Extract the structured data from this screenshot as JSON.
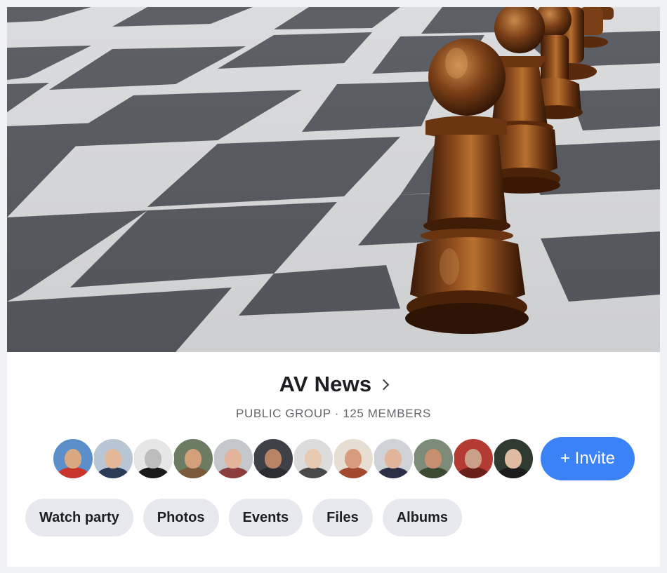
{
  "group": {
    "name": "AV News",
    "privacy": "PUBLIC GROUP",
    "separator": "·",
    "member_count": "125 MEMBERS"
  },
  "cover": {
    "icon": "chess-board-photo",
    "subject": "giant wooden pawn chess pieces on a checkered board"
  },
  "members": [
    {
      "id": "m1",
      "bg": "#5b8fc9",
      "skin": "#d8a883",
      "shirt": "#c9342b"
    },
    {
      "id": "m2",
      "bg": "#b9c6d4",
      "skin": "#e3b898",
      "shirt": "#2a3a57"
    },
    {
      "id": "m3",
      "bg": "#e6e6e6",
      "skin": "#bdbdbd",
      "shirt": "#1a1a1a"
    },
    {
      "id": "m4",
      "bg": "#6b7c63",
      "skin": "#d3a079",
      "shirt": "#7a5a3a"
    },
    {
      "id": "m5",
      "bg": "#c4c7cc",
      "skin": "#e4b49a",
      "shirt": "#8c3d3d"
    },
    {
      "id": "m6",
      "bg": "#3e4147",
      "skin": "#b98466",
      "shirt": "#2b2d31"
    },
    {
      "id": "m7",
      "bg": "#dcdcdc",
      "skin": "#e8c9b2",
      "shirt": "#4a4a4a"
    },
    {
      "id": "m8",
      "bg": "#e6ddd3",
      "skin": "#d89b7e",
      "shirt": "#a14a2f"
    },
    {
      "id": "m9",
      "bg": "#cfd3d8",
      "skin": "#e2b59a",
      "shirt": "#2a2f45"
    },
    {
      "id": "m10",
      "bg": "#7d8c78",
      "skin": "#c78e6f",
      "shirt": "#3c4a34"
    },
    {
      "id": "m11",
      "bg": "#b33b33",
      "skin": "#caa08a",
      "shirt": "#6a1f1b"
    },
    {
      "id": "m12",
      "bg": "#2f3a31",
      "skin": "#e0bba3",
      "shirt": "#1c1c1c"
    }
  ],
  "actions": {
    "invite_label": "+ Invite",
    "chevron_icon": "chevron-right-icon"
  },
  "tabs": [
    {
      "label": "Watch party"
    },
    {
      "label": "Photos"
    },
    {
      "label": "Events"
    },
    {
      "label": "Files"
    },
    {
      "label": "Albums"
    }
  ],
  "colors": {
    "accent": "#3b82f6",
    "tab_bg": "#e8e9ee",
    "text_primary": "#1c1e21",
    "text_secondary": "#65676b"
  }
}
